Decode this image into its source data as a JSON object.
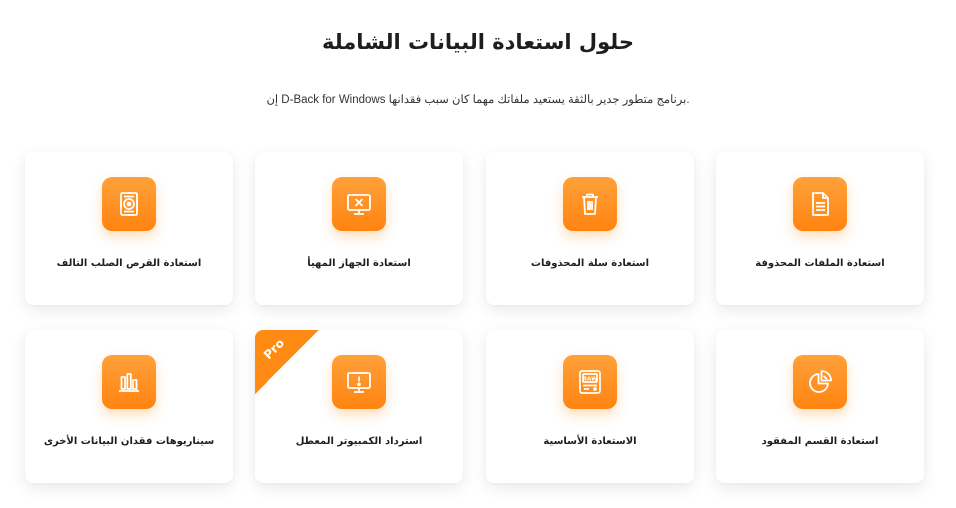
{
  "page": {
    "title": "حلول استعادة البيانات الشاملة",
    "subtitle": "إن D-Back for Windows برنامج متطور جدير بالثقة يستعيد ملفاتك مهما كان سبب فقدانها."
  },
  "colors": {
    "accent": "#ff8b14",
    "accent_light": "#ffa13a"
  },
  "cards": [
    {
      "label": "استعادة الملفات المحذوفة",
      "icon": "document-icon"
    },
    {
      "label": "استعادة سلة المحذوفات",
      "icon": "trash-icon"
    },
    {
      "label": "استعادة الجهاز المهيأ",
      "icon": "monitor-x-icon"
    },
    {
      "label": "استعادة القرص الصلب التالف",
      "icon": "hard-drive-icon"
    },
    {
      "label": "استعادة القسم المفقود",
      "icon": "pie-chart-icon"
    },
    {
      "label": "الاستعادة الأساسية",
      "icon": "raw-drive-icon"
    },
    {
      "label": "استرداد الكمبيوتر المعطل",
      "icon": "monitor-alert-icon",
      "badge": "Pro"
    },
    {
      "label": "سيناريوهات فقدان البيانات الأخرى",
      "icon": "bar-chart-icon"
    }
  ]
}
